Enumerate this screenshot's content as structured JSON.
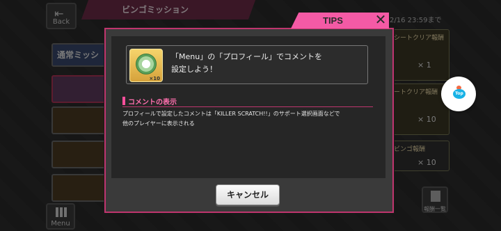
{
  "background": {
    "title": "ビンゴミッション",
    "back_label": "Back",
    "date": "2/16 23:59まで",
    "left_tab": "通常ミッシ",
    "right_cards": [
      {
        "label": "シートクリア報酬",
        "qty": "× 1"
      },
      {
        "label": "ートクリア報酬",
        "qty": "× 10"
      },
      {
        "label": "ビンゴ報酬",
        "qty": "× 10"
      }
    ],
    "menu_label": "Menu",
    "reward_label": "報酬一覧"
  },
  "top_bubble": {
    "label": "Top"
  },
  "dialog": {
    "tips_label": "TIPS",
    "close_label": "✕",
    "header": {
      "icon_count": "×10",
      "text": "「Menu」の「プロフィール」でコメントを\n設定しよう！"
    },
    "section": {
      "title": "コメントの表示",
      "description": "プロフィールで設定したコメントは「KILLER SCRATCH!!」のサポート選択画面などで\n他のプレイヤーに表示される"
    },
    "cancel_label": "キャンセル"
  }
}
